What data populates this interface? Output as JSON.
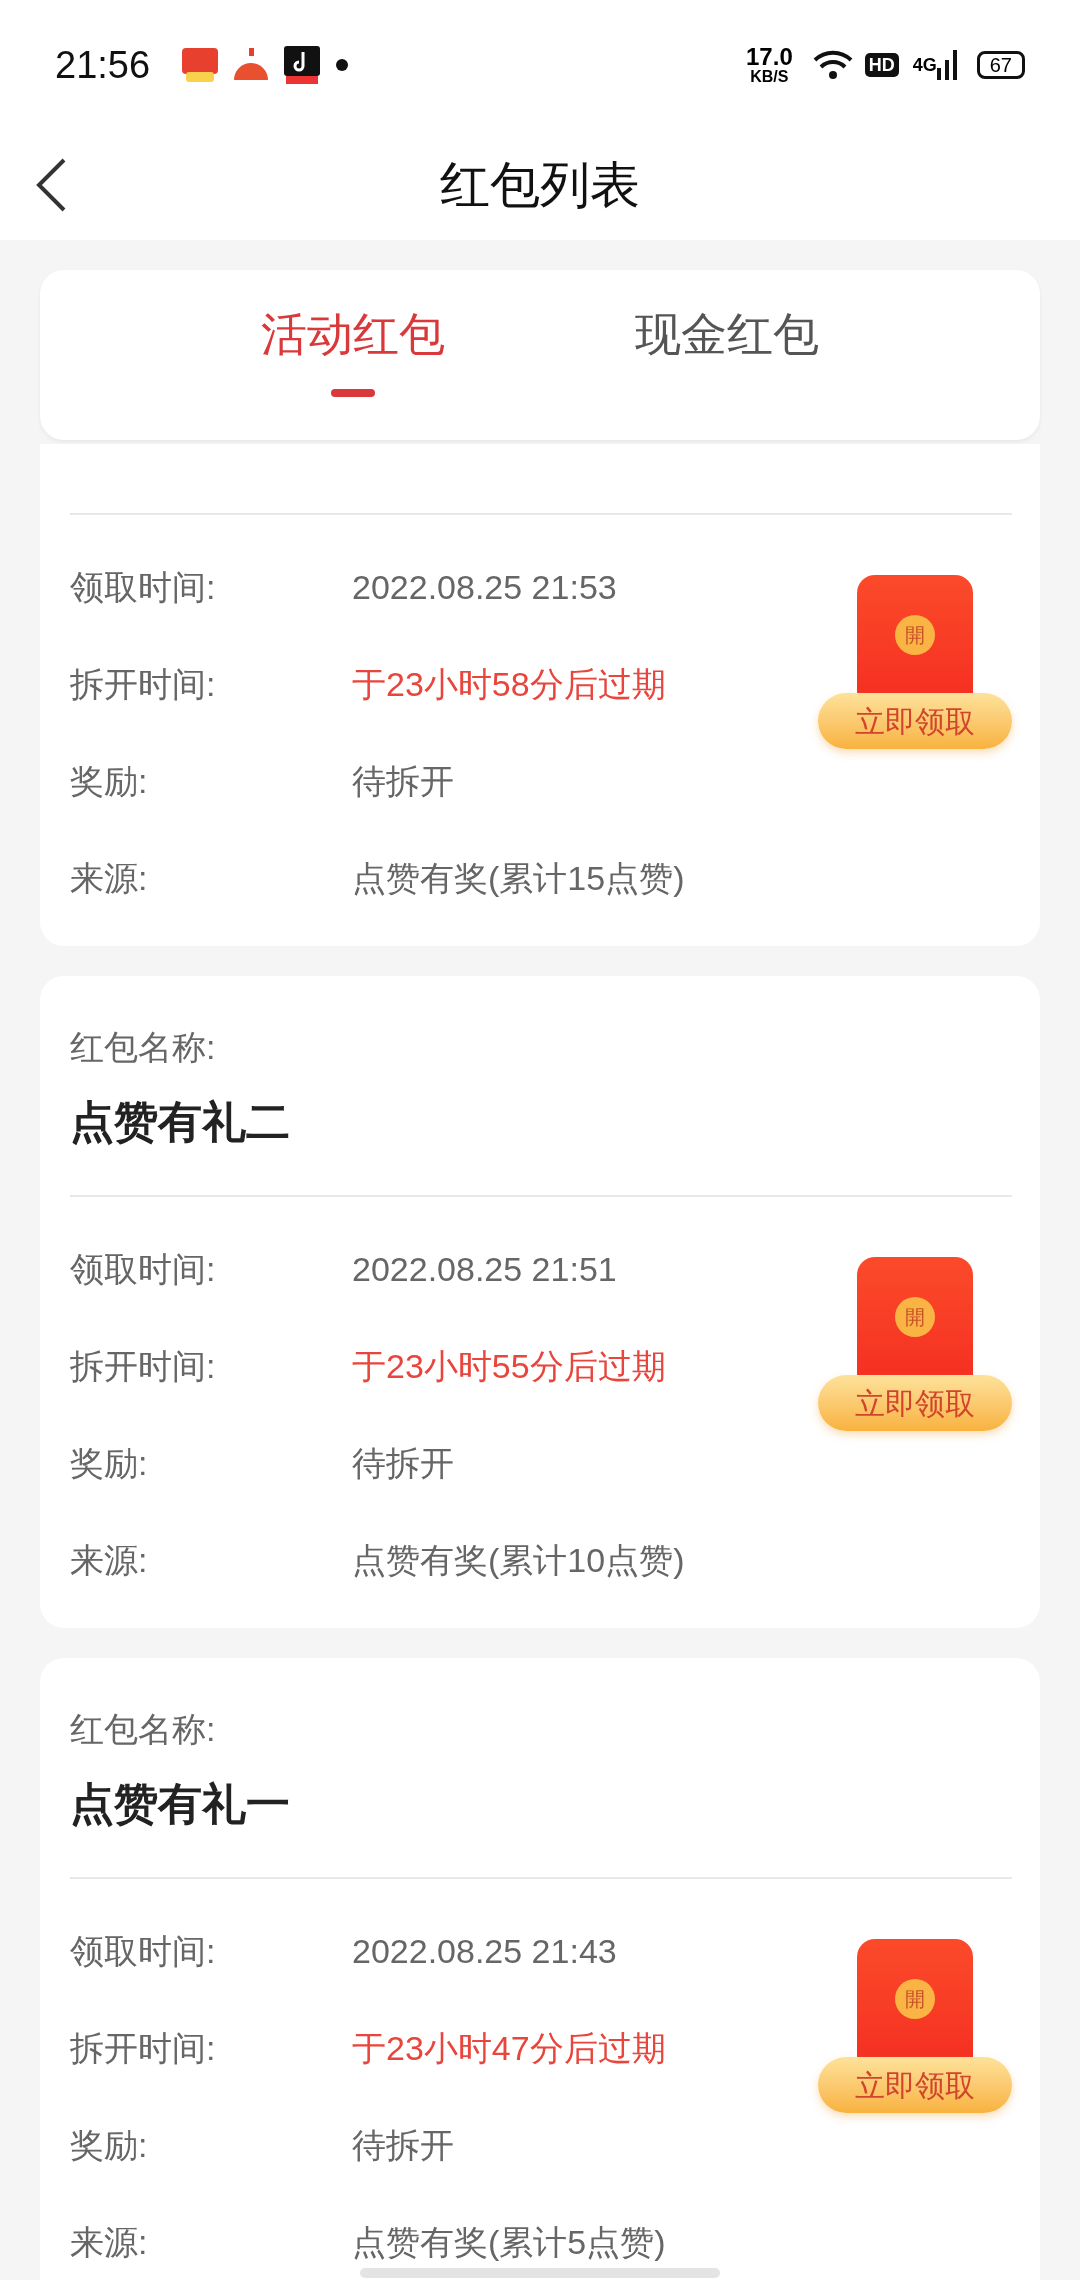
{
  "status_bar": {
    "time": "21:56",
    "speed": "17.0",
    "speed_unit": "KB/S",
    "hd": "HD",
    "network": "4G",
    "battery": "67"
  },
  "header": {
    "title": "红包列表"
  },
  "tabs": [
    {
      "label": "活动红包",
      "selected": true
    },
    {
      "label": "现金红包",
      "selected": false
    }
  ],
  "cards": [
    {
      "rows": [
        {
          "label": "领取时间:",
          "value": "2022.08.25 21:53",
          "alert": false
        },
        {
          "label": "拆开时间:",
          "value": "于23小时58分后过期",
          "alert": true
        },
        {
          "label": "奖励:",
          "value": "待拆开",
          "alert": false
        },
        {
          "label": "来源:",
          "value": "点赞有奖(累计15点赞)",
          "alert": false
        }
      ],
      "seal": "開",
      "button": "立即领取"
    },
    {
      "name_label": "红包名称:",
      "name": "点赞有礼二",
      "rows": [
        {
          "label": "领取时间:",
          "value": "2022.08.25 21:51",
          "alert": false
        },
        {
          "label": "拆开时间:",
          "value": "于23小时55分后过期",
          "alert": true
        },
        {
          "label": "奖励:",
          "value": "待拆开",
          "alert": false
        },
        {
          "label": "来源:",
          "value": "点赞有奖(累计10点赞)",
          "alert": false
        }
      ],
      "seal": "開",
      "button": "立即领取"
    },
    {
      "name_label": "红包名称:",
      "name": "点赞有礼一",
      "rows": [
        {
          "label": "领取时间:",
          "value": "2022.08.25 21:43",
          "alert": false
        },
        {
          "label": "拆开时间:",
          "value": "于23小时47分后过期",
          "alert": true
        },
        {
          "label": "奖励:",
          "value": "待拆开",
          "alert": false
        },
        {
          "label": "来源:",
          "value": "点赞有奖(累计5点赞)",
          "alert": false
        }
      ],
      "seal": "開",
      "button": "立即领取"
    }
  ]
}
